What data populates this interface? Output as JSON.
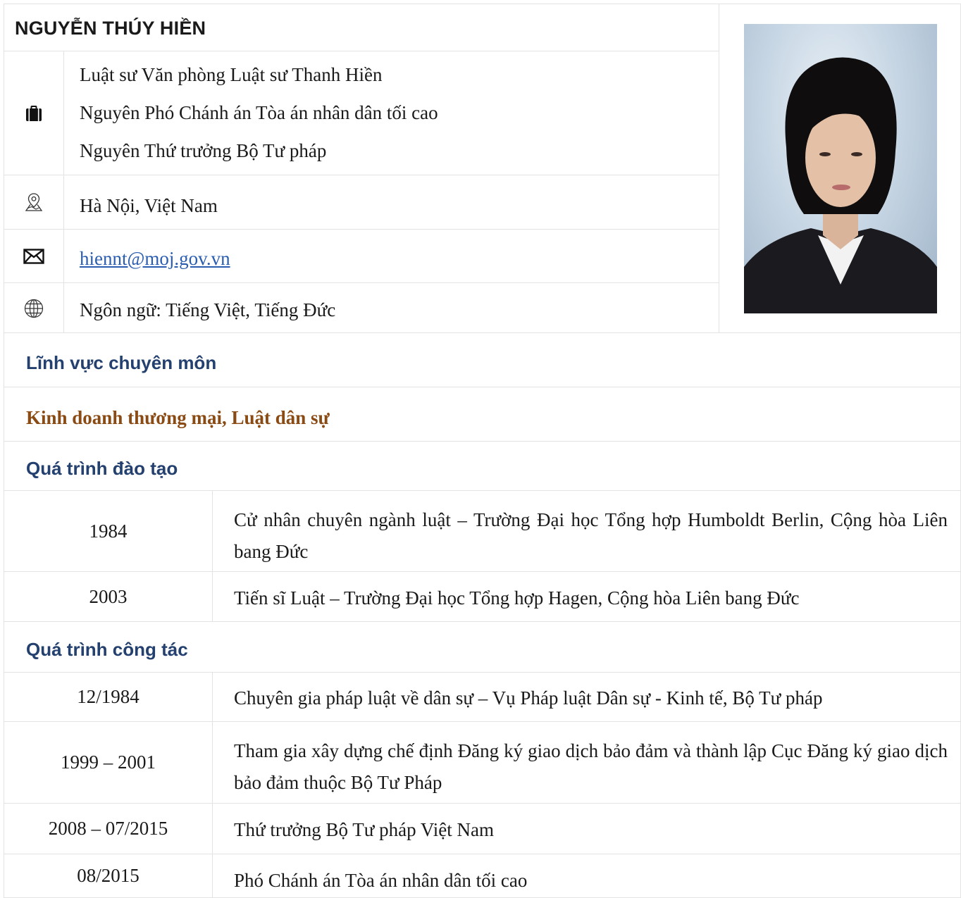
{
  "profile": {
    "name": "NGUYỄN THÚY HIỀN",
    "positions": [
      "Luật sư Văn phòng Luật sư Thanh Hiền",
      "Nguyên Phó Chánh án Tòa án nhân dân tối cao",
      "Nguyên Thứ trưởng Bộ Tư pháp"
    ],
    "location": "Hà Nội, Việt Nam",
    "email": "hiennt@moj.gov.vn",
    "languages": "Ngôn ngữ: Tiếng Việt, Tiếng Đức",
    "icons": {
      "positions": "briefcase-icon",
      "location": "map-pin-icon",
      "email": "envelope-icon",
      "languages": "globe-icon"
    }
  },
  "expertise": {
    "title": "Lĩnh vực chuyên môn",
    "value": "Kinh doanh thương mại, Luật dân sự"
  },
  "education": {
    "title": "Quá trình đào tạo",
    "rows": [
      {
        "year": "1984",
        "desc": "Cử nhân chuyên ngành luật – Trường Đại học Tổng hợp Humboldt Berlin, Cộng hòa Liên bang Đức"
      },
      {
        "year": "2003",
        "desc": "Tiến sĩ Luật  –  Trường Đại học Tổng hợp Hagen, Cộng hòa Liên bang Đức"
      }
    ]
  },
  "career": {
    "title": "Quá trình công tác",
    "rows": [
      {
        "year": "12/1984",
        "desc": "Chuyên gia pháp luật về dân sự – Vụ Pháp luật Dân sự - Kinh tế, Bộ Tư pháp"
      },
      {
        "year": "1999 – 2001",
        "desc": "Tham gia xây dựng chế định Đăng ký giao dịch bảo đảm và thành lập Cục Đăng ký giao dịch bảo đảm thuộc Bộ Tư Pháp"
      },
      {
        "year": "2008 – 07/2015",
        "desc": "Thứ trưởng Bộ Tư pháp Việt Nam"
      },
      {
        "year": "08/2015",
        "desc": "Phó Chánh án Tòa án nhân dân tối cao"
      }
    ]
  },
  "colors": {
    "section_title": "#23406f",
    "expertise_text": "#8a4a14",
    "link": "#2a5db0",
    "border": "#e3e3e3"
  }
}
